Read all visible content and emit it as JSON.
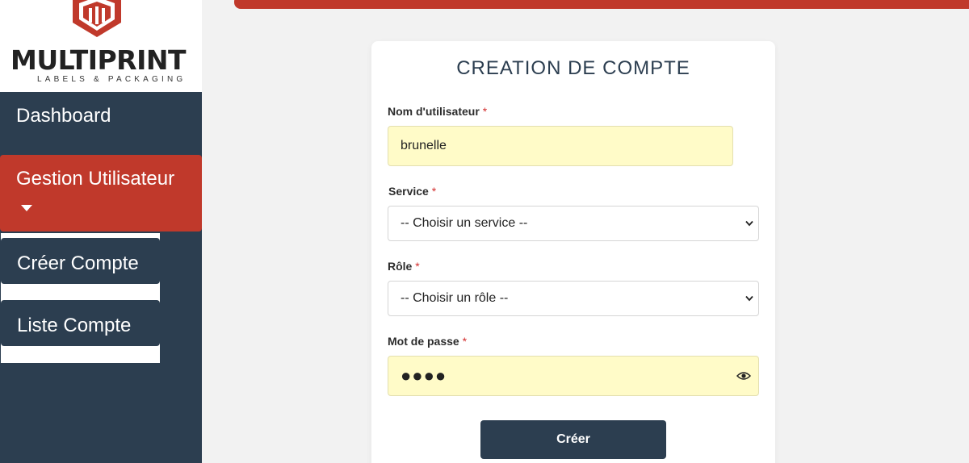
{
  "brand": {
    "name": "MULTIPRINT",
    "tagline": "LABELS & PACKAGING",
    "colors": {
      "primary": "#2c3e50",
      "accent": "#c0392b",
      "autofill": "#fffbc8"
    }
  },
  "sidebar": {
    "dashboard": "Dashboard",
    "gestion": "Gestion Utilisateur",
    "caret_icon": "caret-down-icon",
    "submenu": [
      "Créer Compte",
      "Liste Compte"
    ]
  },
  "form": {
    "title": "CREATION DE COMPTE",
    "required_mark": "*",
    "username": {
      "label": "Nom d'utilisateur",
      "value": "brunelle"
    },
    "service": {
      "label": "Service",
      "selected": "-- Choisir un service --"
    },
    "role": {
      "label": "Rôle",
      "selected": "-- Choisir un rôle --"
    },
    "password": {
      "label": "Mot de passe",
      "masked": "●●●●",
      "toggle_icon": "eye-icon"
    },
    "submit": "Créer"
  }
}
